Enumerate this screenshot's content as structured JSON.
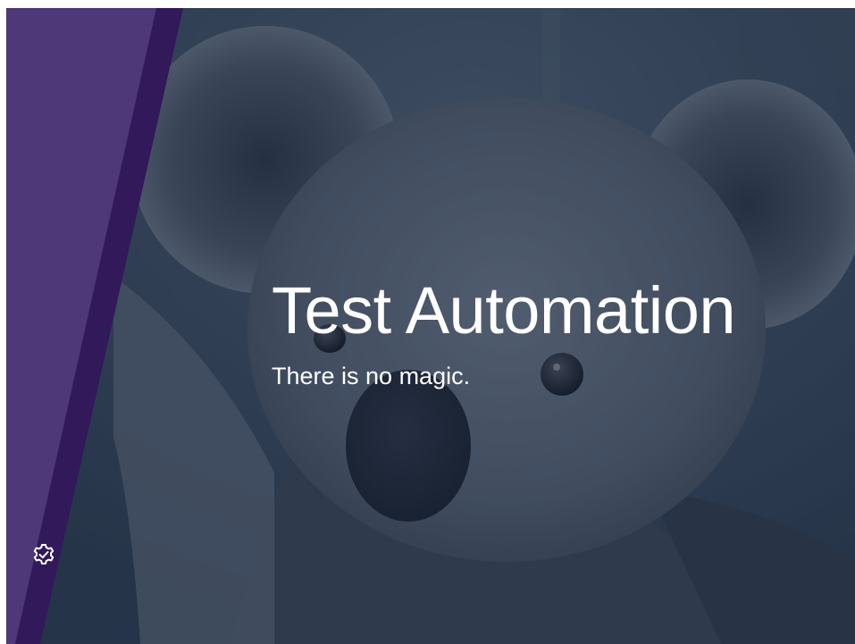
{
  "slide": {
    "title": "Test Automation",
    "subtitle": "There is no magic.",
    "background_image": "koala-photo",
    "colors": {
      "band_light": "#4e3878",
      "band_dark": "#31195a",
      "text": "#ffffff"
    },
    "icons": {
      "logo": "gear-check-icon"
    }
  }
}
